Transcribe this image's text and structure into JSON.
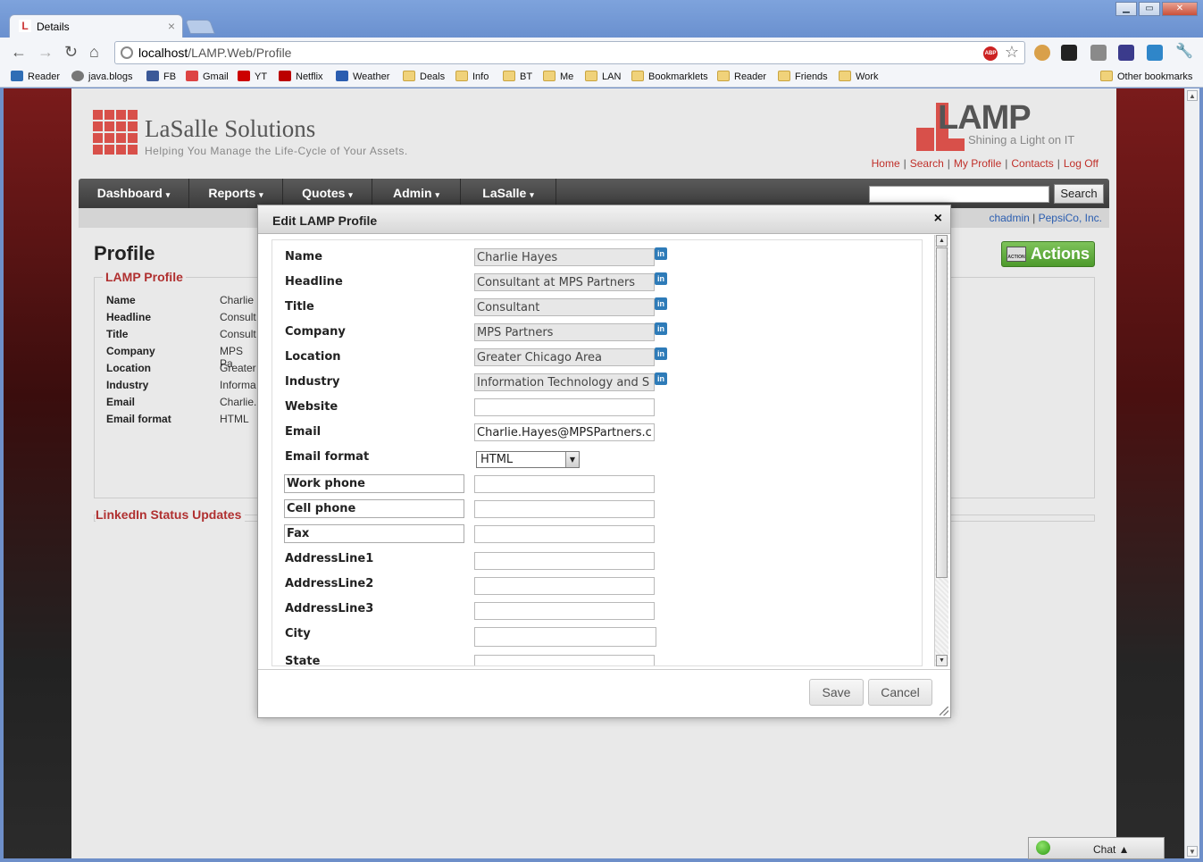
{
  "browser": {
    "tab_title": "Details",
    "tab_favicon": "L",
    "url_host": "localhost",
    "url_path": "/LAMP.Web/Profile",
    "bookmarks": [
      "Reader",
      "java.blogs",
      "FB",
      "Gmail",
      "YT",
      "Netflix",
      "Weather",
      "Deals",
      "Info",
      "BT",
      "Me",
      "LAN",
      "Bookmarklets",
      "Reader",
      "Friends",
      "Work"
    ],
    "other_bookmarks": "Other bookmarks"
  },
  "site": {
    "brand": "LaSalle Solutions",
    "tagline": "Helping You Manage the Life-Cycle of Your Assets.",
    "lamp_name": "LAMP",
    "lamp_tagline": "Shining a Light on IT",
    "top_links": [
      "Home",
      "Search",
      "My Profile",
      "Contacts",
      "Log Off"
    ],
    "nav": [
      "Dashboard",
      "Reports",
      "Quotes",
      "Admin",
      "LaSalle"
    ],
    "search_button": "Search",
    "user": "chadmin",
    "org": "PepsiCo, Inc."
  },
  "profile_page": {
    "title": "Profile",
    "actions_label": "Actions",
    "section_title": "LAMP Profile",
    "linkedin_title": "LinkedIn Status Updates",
    "rows": [
      {
        "k": "Name",
        "v": "Charlie"
      },
      {
        "k": "Headline",
        "v": "Consult"
      },
      {
        "k": "Title",
        "v": "Consult"
      },
      {
        "k": "Company",
        "v": "MPS Pa"
      },
      {
        "k": "Location",
        "v": "Greater"
      },
      {
        "k": "Industry",
        "v": "Informa"
      },
      {
        "k": "Email",
        "v": "Charlie."
      },
      {
        "k": "Email format",
        "v": "HTML"
      }
    ]
  },
  "modal": {
    "title": "Edit LAMP Profile",
    "close": "×",
    "fields": {
      "name": {
        "label": "Name",
        "value": "Charlie Hayes"
      },
      "headline": {
        "label": "Headline",
        "value": "Consultant at MPS Partners"
      },
      "title": {
        "label": "Title",
        "value": "Consultant"
      },
      "company": {
        "label": "Company",
        "value": "MPS Partners"
      },
      "location": {
        "label": "Location",
        "value": "Greater Chicago Area"
      },
      "industry": {
        "label": "Industry",
        "value": "Information Technology and S"
      },
      "website": {
        "label": "Website",
        "value": ""
      },
      "email": {
        "label": "Email",
        "value": "Charlie.Hayes@MPSPartners.c"
      },
      "email_format": {
        "label": "Email format",
        "value": "HTML"
      },
      "work_phone": {
        "label": "Work phone",
        "value": ""
      },
      "cell_phone": {
        "label": "Cell phone",
        "value": ""
      },
      "fax": {
        "label": "Fax",
        "value": ""
      },
      "address1": {
        "label": "AddressLine1",
        "value": ""
      },
      "address2": {
        "label": "AddressLine2",
        "value": ""
      },
      "address3": {
        "label": "AddressLine3",
        "value": ""
      },
      "city": {
        "label": "City",
        "value": ""
      },
      "state": {
        "label": "State",
        "value": ""
      }
    },
    "linkedin_badge": "in",
    "save": "Save",
    "cancel": "Cancel"
  },
  "chat": {
    "label": "Chat ▲"
  },
  "colors": {
    "accent": "#c0302a",
    "link": "#2a5db0",
    "actions": "#5aa834"
  }
}
